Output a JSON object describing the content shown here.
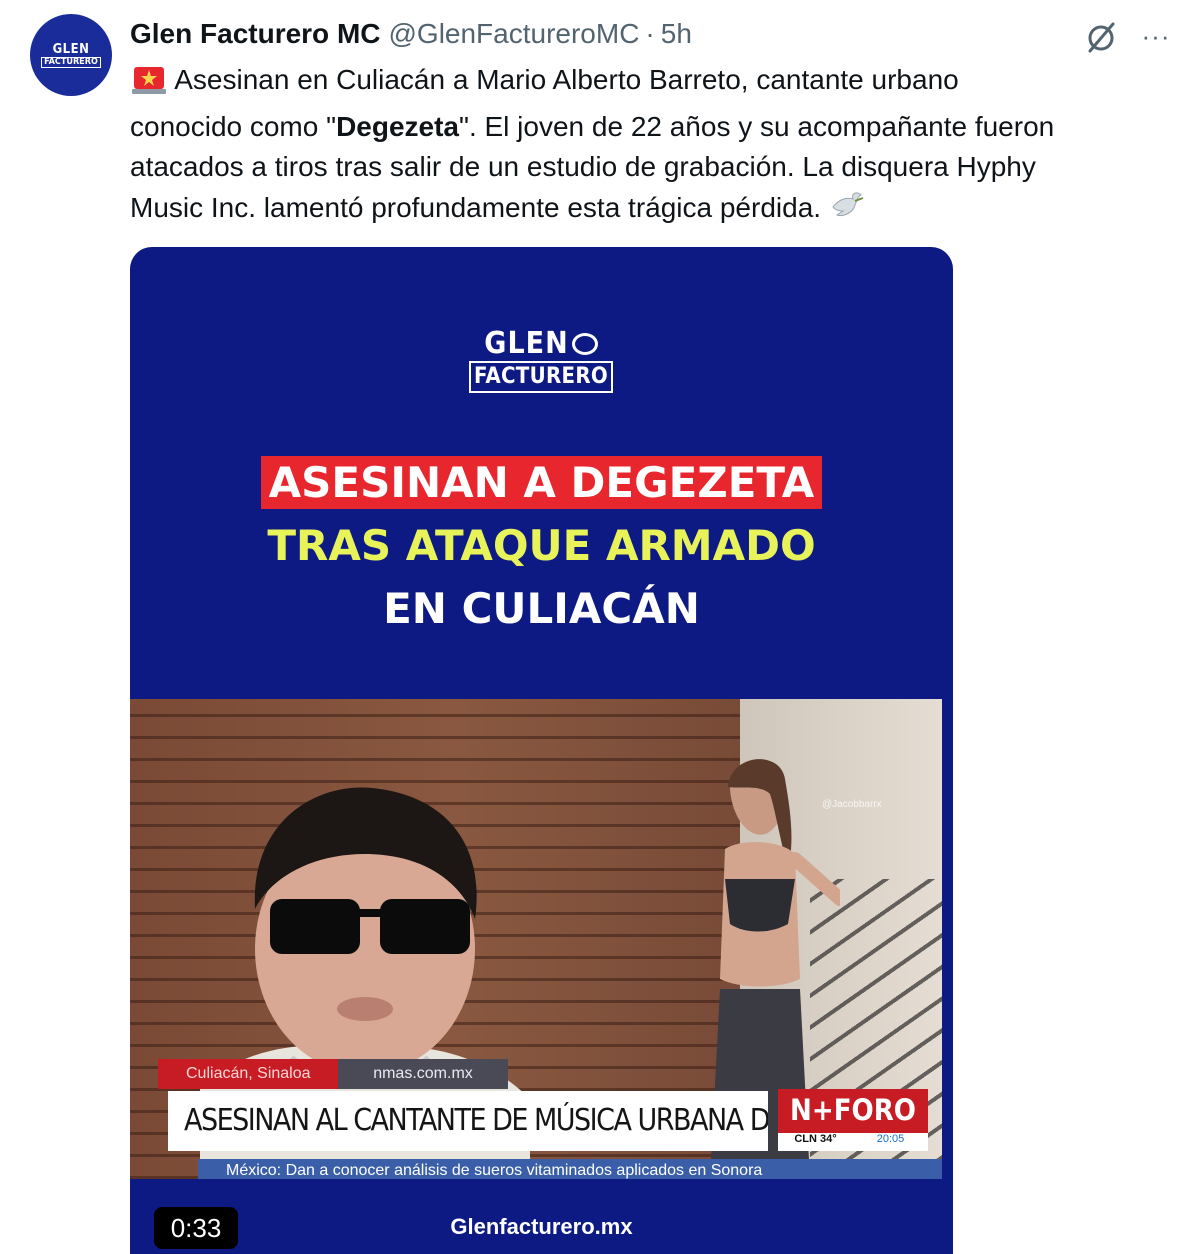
{
  "tweet": {
    "avatar_text_top": "GLEN",
    "avatar_text_bottom": "FACTURERO",
    "display_name": "Glen Facturero MC",
    "handle": "@GlenFactureroMC",
    "separator": "·",
    "time": "5h",
    "more_label": "···",
    "text_line1": "Asesinan en Culiacán a Mario Alberto Barreto, cantante urbano",
    "text_line2_before": "conocido como \"",
    "text_line2_bold": "Degezeta",
    "text_line2_after": "\". El joven de 22 años y su acompañante fueron",
    "text_line3": "atacados a tiros tras salir de un estudio de grabación. La disquera Hyphy",
    "text_line4": "Music Inc. lamentó profundamente esta trágica pérdida.",
    "emoji_start": "🚨",
    "emoji_end": "🕊"
  },
  "media": {
    "logo_top": "GLEN",
    "logo_bottom": "FACTURERO",
    "headline_1": "ASESINAN A DEGEZETA",
    "headline_2": "TRAS ATAQUE ARMADO",
    "headline_3": "EN CULIACÁN",
    "watermark": "@Jacobbarrx",
    "location_tag": "Culiacán, Sinaloa",
    "site_tag": "nmas.com.mx",
    "news_headline": "ASESINAN AL CANTANTE DE MÚSICA URBANA DEGEZETA",
    "brand": "N+FORO",
    "brand_temp": "CLN 34°",
    "brand_time": "20:05",
    "ticker": "México: Dan a conocer análisis de sueros vitaminados aplicados en Sonora",
    "timer": "0:33",
    "footer_site": "Glenfacturero.mx"
  },
  "colors": {
    "media_bg": "#0d1a83",
    "headline_red": "#e8262e",
    "headline_yellow": "#e8f35a",
    "text_secondary": "#536471",
    "brand_red": "#c71c23"
  }
}
